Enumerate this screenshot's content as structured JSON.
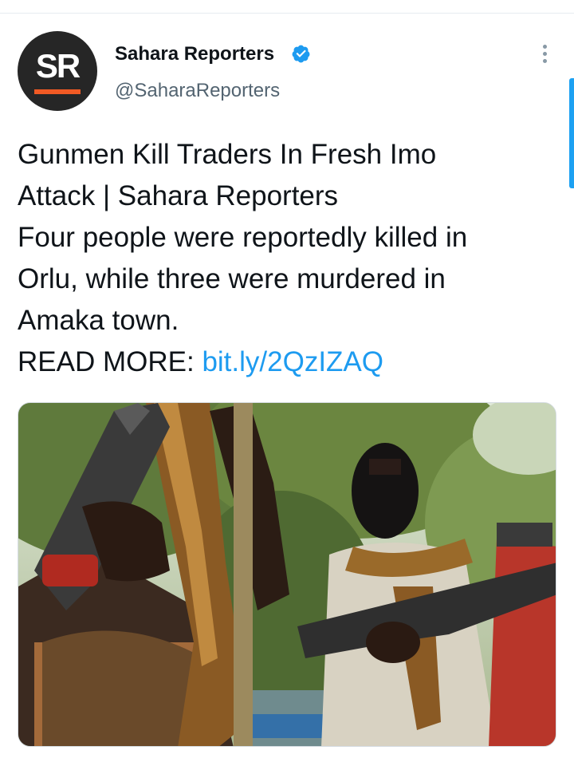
{
  "account": {
    "display_name": "Sahara Reporters",
    "handle": "@SaharaReporters",
    "avatar_text": "SR",
    "verified": true
  },
  "tweet": {
    "lines": [
      "Gunmen Kill Traders In Fresh Imo",
      "Attack | Sahara Reporters",
      "Four people were reportedly killed in",
      "Orlu, while three were murdered in",
      "Amaka town."
    ],
    "read_more_label": "READ MORE:",
    "link_text": "bit.ly/2QzIZAQ"
  },
  "icons": {
    "verified": "verified-badge-icon",
    "more": "more-options-icon"
  },
  "colors": {
    "link": "#1d9bf0",
    "verified": "#1d9bf0",
    "avatar_bg": "#262626",
    "avatar_accent": "#f15a24",
    "handle": "#536471"
  }
}
